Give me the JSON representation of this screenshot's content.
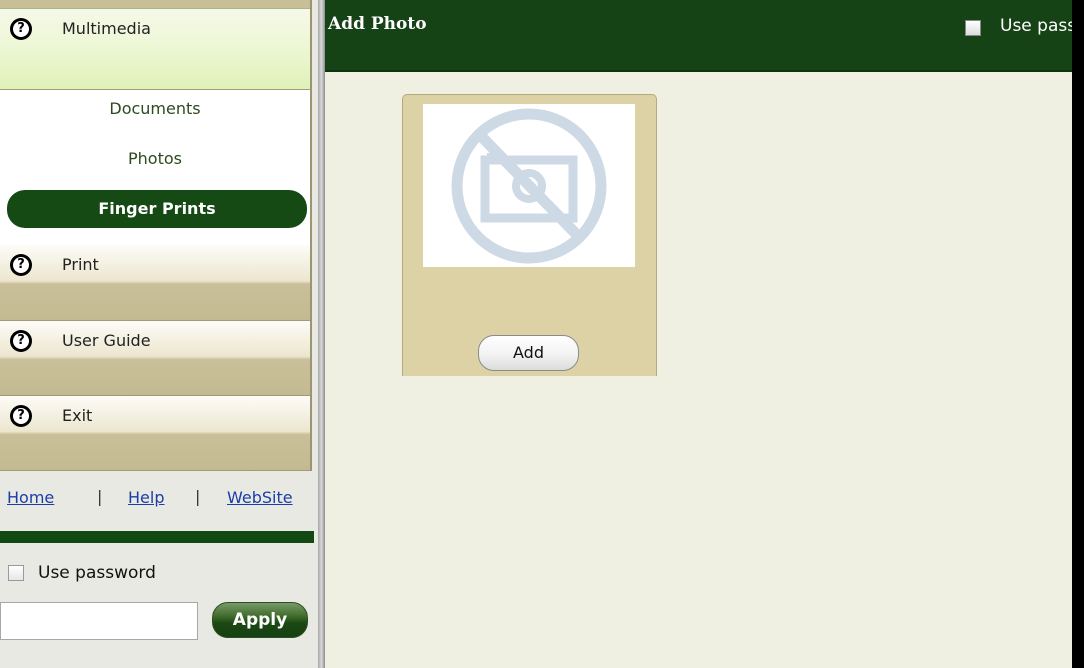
{
  "sidebar": {
    "sections": [
      {
        "label": "Multimedia",
        "icon": "help-circle-icon"
      },
      {
        "label": "Print",
        "icon": "help-circle-icon"
      },
      {
        "label": "User Guide",
        "icon": "help-circle-icon"
      },
      {
        "label": "Exit",
        "icon": "help-circle-icon"
      }
    ],
    "icon_glyph": "?",
    "submenu": [
      "Documents",
      "Photos",
      "Finger Prints"
    ],
    "active_submenu": "Finger Prints",
    "links": [
      "Home",
      "Help",
      "WebSite"
    ],
    "link_separator": "|",
    "password": {
      "checkbox_label": "Use password",
      "checked": false,
      "input_value": "",
      "apply_label": "Apply"
    }
  },
  "main": {
    "title": "Add Photo",
    "header_checkbox_label": "Use pass",
    "header_checked": false,
    "photo_card": {
      "placeholder_icon": "no-image-icon",
      "add_label": "Add"
    }
  },
  "colors": {
    "dark_green": "#164316",
    "panel_bg": "#f0f0e2",
    "card_bg": "#ddd2a6",
    "link_blue": "#1b3da8"
  }
}
